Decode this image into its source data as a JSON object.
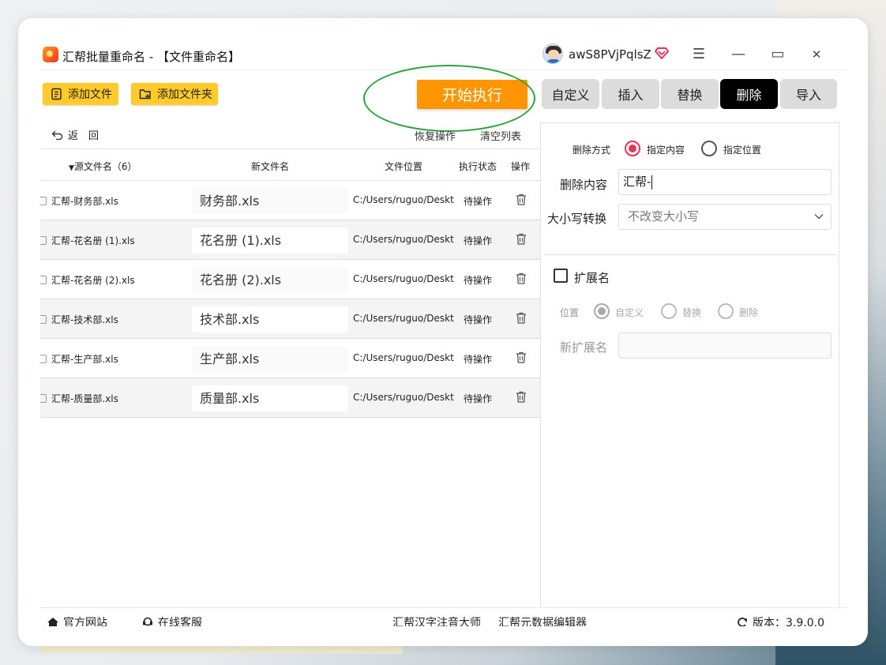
{
  "window": {
    "title": "汇帮批量重命名 - 【文件重命名】",
    "username": "awS8PVjPqlsZ",
    "controls": {
      "menu": "☰",
      "minimize": "—",
      "maximize": "▭",
      "close": "✕"
    }
  },
  "toolbar": {
    "add_file": "添加文件",
    "add_folder": "添加文件夹",
    "start": "开始执行"
  },
  "tabs": [
    {
      "label": "自定义",
      "active": false
    },
    {
      "label": "插入",
      "active": false
    },
    {
      "label": "替换",
      "active": false
    },
    {
      "label": "删除",
      "active": true
    },
    {
      "label": "导入",
      "active": false
    }
  ],
  "actions": {
    "back": "返　回",
    "restore": "恢复操作",
    "clear": "清空列表"
  },
  "table": {
    "headers": {
      "source": "源文件名（6）",
      "new_name": "新文件名",
      "location": "文件位置",
      "status": "执行状态",
      "op": "操作"
    },
    "rows": [
      {
        "source": "汇帮-财务部.xls",
        "new": "财务部.xls",
        "path": "C:/Users/ruguo/Desktop",
        "status": "待操作"
      },
      {
        "source": "汇帮-花名册 (1).xls",
        "new": "花名册 (1).xls",
        "path": "C:/Users/ruguo/Desktop",
        "status": "待操作"
      },
      {
        "source": "汇帮-花名册 (2).xls",
        "new": "花名册 (2).xls",
        "path": "C:/Users/ruguo/Desktop",
        "status": "待操作"
      },
      {
        "source": "汇帮-技术部.xls",
        "new": "技术部.xls",
        "path": "C:/Users/ruguo/Desktop",
        "status": "待操作"
      },
      {
        "source": "汇帮-生产部.xls",
        "new": "生产部.xls",
        "path": "C:/Users/ruguo/Desktop",
        "status": "待操作"
      },
      {
        "source": "汇帮-质量部.xls",
        "new": "质量部.xls",
        "path": "C:/Users/ruguo/Desktop",
        "status": "待操作"
      }
    ]
  },
  "panel": {
    "delete_mode_label": "删除方式",
    "mode_content": "指定内容",
    "mode_position": "指定位置",
    "content_label": "删除内容",
    "content_value": "汇帮-",
    "case_label": "大小写转换",
    "case_value": "不改变大小写",
    "ext_label": "扩展名",
    "position_label": "位置",
    "opt_custom": "自定义",
    "opt_replace": "替换",
    "opt_delete": "删除",
    "new_ext_label": "新扩展名",
    "new_ext_value": ""
  },
  "footer": {
    "website": "官方网站",
    "support": "在线客服",
    "link1": "汇帮汉字注音大师",
    "link2": "汇帮元数据编辑器",
    "version": "版本：3.9.0.0"
  },
  "colors": {
    "accent_yellow": "#ffcb2b",
    "start_orange": "#ff9500",
    "radio_active": "#e8325a",
    "highlight_ellipse": "#2aa43a"
  }
}
